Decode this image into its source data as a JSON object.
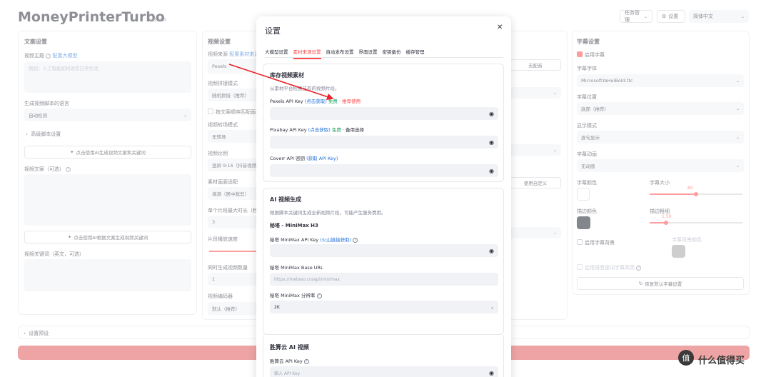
{
  "app": {
    "title": "MoneyPrinterTurbo",
    "version": "v1.3.6"
  },
  "top": {
    "task_mgmt": "任务管理",
    "settings": "设置",
    "lang": "简体中文"
  },
  "script_panel": {
    "title": "文案设置",
    "topic_label": "视频主题",
    "topic_link": "配置大模型",
    "topic_placeholder": "例如：人工智能如何改变日常生活",
    "lang_label": "生成视频脚本的语言",
    "lang_value": "自动检测",
    "advanced": "高级脚本设置",
    "gen_btn": "点击使用AI生成视频文案和关键词",
    "copy_label": "视频文案（可选）",
    "gen_kw_btn": "点击使用AI根据文案生成视频关键词",
    "kw_label": "视频关键词（英文，可选）"
  },
  "video_panel": {
    "title": "视频设置",
    "source_label": "视频来源",
    "source_link": "配置素材来源",
    "source_value": "Pexels",
    "concat_label": "视频拼接模式",
    "concat_value": "随机拼接（推荐）",
    "match_label": "按文案顺序匹配画面",
    "transition_label": "视频转场模式",
    "transition_value": "无转场",
    "ratio_label": "视频比例",
    "ratio_value": "竖屏 9:16（抖音视频）",
    "fit_label": "素材画面适配",
    "fit_value": "填满（居中裁剪）",
    "maxlen_label": "单个片段最大时长（秒）",
    "maxlen_value": "3",
    "speed_label": "片段播放速度",
    "count_label": "同时生成视频数量",
    "count_value": "1",
    "codec_label": "视频编码器",
    "codec_value": "默认（推荐）"
  },
  "mid_fragments": {
    "no_voice": "无配音",
    "custom_voice": "使用自定义"
  },
  "subtitle_panel": {
    "title": "字幕设置",
    "enable": "启用字幕",
    "font_label": "字幕字体",
    "font_value": "MicrosoftYaHeiBold.ttc",
    "position_label": "字幕位置",
    "position_value": "底部（推荐）",
    "display_label": "显示模式",
    "display_value": "逐句显示",
    "anim_label": "字幕动画",
    "anim_value": "无动画",
    "color_label": "字幕颜色",
    "size_label": "字幕大小",
    "size_value": "60",
    "size_frac": 0.5,
    "stroke_color_label": "描边颜色",
    "stroke_label": "描边粗细",
    "stroke_value": "1.50",
    "stroke_frac": 0.18,
    "bg_label": "启用字幕背景",
    "bg_color_label": "字幕背景颜色",
    "highlight_label": "启用语音逐词字幕高亮",
    "reset_btn": "恢复默认字幕设置"
  },
  "preset": "设置预设",
  "modal": {
    "title": "设置",
    "tabs": [
      "大模型设置",
      "素材来源设置",
      "自动发布设置",
      "界面设置",
      "密钥备份",
      "缓存管理"
    ],
    "active_tab": 1,
    "stock": {
      "title": "库存视频素材",
      "desc": "从素材平台检索已有的视频片段。",
      "pexels_label": "Pexels API Key",
      "pexels_link": "(点击获取)",
      "pexels_free": "免费",
      "pexels_rec": "· 推荐使用",
      "pixabay_label": "Pixabay API Key",
      "pixabay_link": "(点击获取)",
      "pixabay_free": "免费",
      "pixabay_rec": "· 备用选择",
      "coverr_label": "Coverr API 密钥",
      "coverr_link": "(获取 API Key)"
    },
    "ai": {
      "title": "AI 视频生成",
      "desc": "根据脚本关键词生成全新视频片段，可能产生服务费用。",
      "minimax_title": "秘塔 - MiniMax H3",
      "key_label": "秘塔 MiniMax API Key",
      "key_link": "(火山链接获取)",
      "base_label": "秘塔 MiniMax Base URL",
      "base_placeholder": "https://metaso.cn/api/minimax",
      "res_label": "秘塔 MiniMax 分辨率",
      "res_value": "2K"
    },
    "sc": {
      "title": "胜算云 AI 视频",
      "key_label": "胜算云 API Key",
      "key_placeholder": "输入 API Key"
    }
  },
  "watermark": "什么值得买",
  "colors": {
    "accent": "#ff4b4b",
    "stroke_swatch": "#1e2330",
    "bg_swatch": "#a6a6a6",
    "arrow": "#e8232a"
  }
}
